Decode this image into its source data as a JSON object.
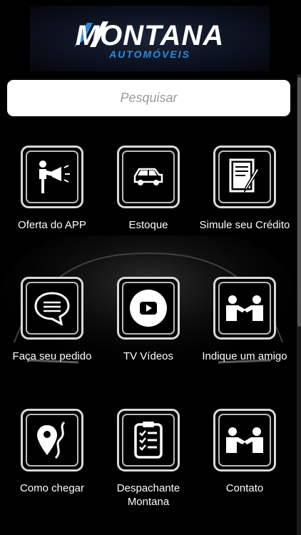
{
  "header": {
    "brand_main": "MONTANA",
    "brand_sub": "AUTOMÓVEIS"
  },
  "search": {
    "placeholder": "Pesquisar"
  },
  "tiles": [
    {
      "label": "Oferta do APP",
      "icon": "megaphone-person-icon"
    },
    {
      "label": "Estoque",
      "icon": "car-icon"
    },
    {
      "label": "Simule seu Crédito",
      "icon": "document-pen-icon"
    },
    {
      "label": "Faça seu pedido",
      "icon": "chat-bubble-icon"
    },
    {
      "label": "TV Vídeos",
      "icon": "play-icon"
    },
    {
      "label": "Indique um amigo",
      "icon": "handshake-icon"
    },
    {
      "label": "Como chegar",
      "icon": "map-pin-icon"
    },
    {
      "label": "Despachante Montana",
      "icon": "clipboard-checklist-icon"
    },
    {
      "label": "Contato",
      "icon": "handshake-icon"
    }
  ],
  "colors": {
    "background": "#000000",
    "brand_blue": "#2f8ad8",
    "tile_border": "#d8d8d8",
    "search_bg": "#ffffff"
  }
}
